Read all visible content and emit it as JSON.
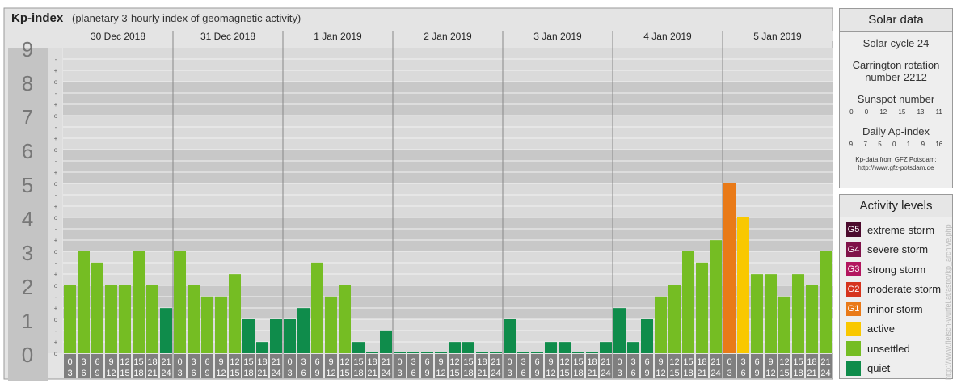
{
  "header": {
    "title": "Kp-index",
    "subtitle": "(planetary 3-hourly index of geomagnetic activity)"
  },
  "chart_data": {
    "type": "bar",
    "ylim": [
      0,
      9
    ],
    "y_major_labels": [
      "0",
      "1",
      "2",
      "3",
      "4",
      "5",
      "6",
      "7",
      "8",
      "9"
    ],
    "y_minor_labels": [
      "o",
      "+",
      "-"
    ],
    "days": [
      "30 Dec 2018",
      "31 Dec 2018",
      "1 Jan 2019",
      "2 Jan 2019",
      "3 Jan 2019",
      "4 Jan 2019",
      "5 Jan 2019"
    ],
    "interval_start": [
      "0",
      "3",
      "6",
      "9",
      "12",
      "15",
      "18",
      "21"
    ],
    "interval_end": [
      "3",
      "6",
      "9",
      "12",
      "15",
      "18",
      "21",
      "24"
    ],
    "values": [
      2.0,
      3.0,
      2.67,
      2.0,
      2.0,
      3.0,
      2.0,
      1.33,
      3.0,
      2.0,
      1.67,
      1.67,
      2.33,
      1.0,
      0.33,
      1.0,
      1.0,
      1.33,
      2.67,
      1.67,
      2.0,
      0.33,
      0.0,
      0.67,
      0.0,
      0.0,
      0.0,
      0.0,
      0.33,
      0.33,
      0.0,
      0.0,
      1.0,
      0.0,
      0.0,
      0.33,
      0.33,
      0.0,
      0.0,
      0.33,
      1.33,
      0.33,
      1.0,
      1.67,
      2.0,
      3.0,
      2.67,
      3.33,
      5.0,
      4.0,
      2.33,
      2.33,
      1.67,
      2.33,
      2.0,
      3.0
    ],
    "colors": {
      "quiet": "#0f8c4b",
      "unsettled": "#75bd23",
      "active": "#f9c800",
      "G1": "#e97a18",
      "G2": "#d6341d",
      "G3": "#b3165f",
      "G4": "#7f1249",
      "G5": "#4b0a2d"
    }
  },
  "solar_data": {
    "title": "Solar data",
    "solar_cycle": "Solar cycle 24",
    "carrington_line1": "Carrington rotation",
    "carrington_line2": "number 2212",
    "sunspot_title": "Sunspot number",
    "sunspot_numbers": [
      "0",
      "0",
      "12",
      "15",
      "13",
      "11"
    ],
    "ap_title": "Daily Ap-index",
    "ap_numbers": [
      "9",
      "7",
      "5",
      "0",
      "1",
      "9",
      "16"
    ],
    "source_line1": "Kp-data from GFZ Potsdam:",
    "source_line2": "http://www.gfz-potsdam.de"
  },
  "activity_levels": {
    "title": "Activity levels",
    "items": [
      {
        "code": "G5",
        "label": "extreme storm",
        "color": "#4b0a2d"
      },
      {
        "code": "G4",
        "label": "severe storm",
        "color": "#7f1249"
      },
      {
        "code": "G3",
        "label": "strong storm",
        "color": "#b3165f"
      },
      {
        "code": "G2",
        "label": "moderate storm",
        "color": "#d6341d"
      },
      {
        "code": "G1",
        "label": "minor storm",
        "color": "#e97a18"
      },
      {
        "code": "",
        "label": "active",
        "color": "#f9c800"
      },
      {
        "code": "",
        "label": "unsettled",
        "color": "#75bd23"
      },
      {
        "code": "",
        "label": "quiet",
        "color": "#0f8c4b"
      }
    ]
  },
  "watermark": "http://www.fleisch-wurfel.at/astro/kp_archive.php"
}
